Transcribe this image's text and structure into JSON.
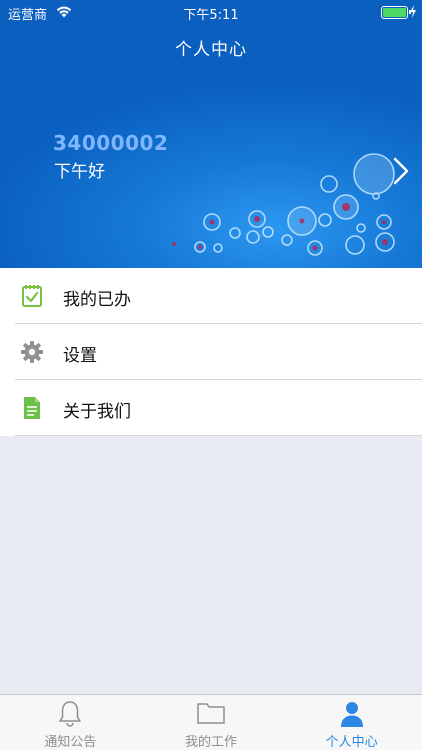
{
  "status_bar": {
    "carrier": "运营商",
    "time": "下午5:11"
  },
  "header": {
    "title": "个人中心",
    "user_id": "34000002",
    "greeting": "下午好"
  },
  "menu": {
    "items": [
      {
        "label": "我的已办",
        "icon": "checklist-icon"
      },
      {
        "label": "设置",
        "icon": "gear-icon"
      },
      {
        "label": "关于我们",
        "icon": "document-icon"
      }
    ]
  },
  "tab_bar": {
    "tabs": [
      {
        "label": "通知公告",
        "icon": "bell-icon",
        "active": false
      },
      {
        "label": "我的工作",
        "icon": "folder-icon",
        "active": false
      },
      {
        "label": "个人中心",
        "icon": "person-icon",
        "active": true
      }
    ]
  },
  "colors": {
    "header_blue": "#1679d6",
    "user_id": "#7fb6ff",
    "active_tab": "#2b87e3",
    "menu_icon_green": "#7ac142",
    "background": "#e8ebf2"
  }
}
